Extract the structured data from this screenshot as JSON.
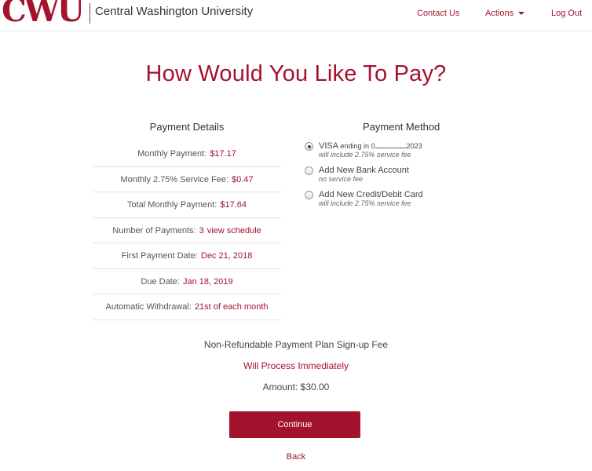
{
  "header": {
    "logo_text": "CWU",
    "university_name": "Central Washington University",
    "nav": {
      "contact": "Contact Us",
      "actions": "Actions",
      "logout": "Log Out"
    }
  },
  "title": "How Would You Like To Pay?",
  "details": {
    "heading": "Payment Details",
    "rows": [
      {
        "label": "Monthly Payment:",
        "value": "$17.17"
      },
      {
        "label": "Monthly 2.75% Service Fee:",
        "value": "$0.47"
      },
      {
        "label": "Total Monthly Payment:",
        "value": "$17.64"
      },
      {
        "label": "Number of Payments:",
        "value": "3",
        "link": "view schedule"
      },
      {
        "label": "First Payment Date:",
        "value": "Dec 21, 2018"
      },
      {
        "label": "Due Date:",
        "value": "Jan 18, 2019"
      },
      {
        "label": "Automatic Withdrawal:",
        "value": "21st of each month"
      }
    ]
  },
  "method": {
    "heading": "Payment Method",
    "options": [
      {
        "label_prefix": "VISA",
        "label_mid": "ending in 0",
        "label_suffix": "2023",
        "note": "will include 2.75% service fee",
        "checked": true
      },
      {
        "label": "Add New Bank Account",
        "note": "no service fee",
        "checked": false
      },
      {
        "label": "Add New Credit/Debit Card",
        "note": "will include 2.75% service fee",
        "checked": false
      }
    ]
  },
  "fee": {
    "title": "Non-Refundable Payment Plan Sign-up Fee",
    "process": "Will Process Immediately",
    "amount": "Amount: $30.00"
  },
  "buttons": {
    "continue": "Continue",
    "back": "Back"
  },
  "colors": {
    "brand": "#a3132e"
  }
}
